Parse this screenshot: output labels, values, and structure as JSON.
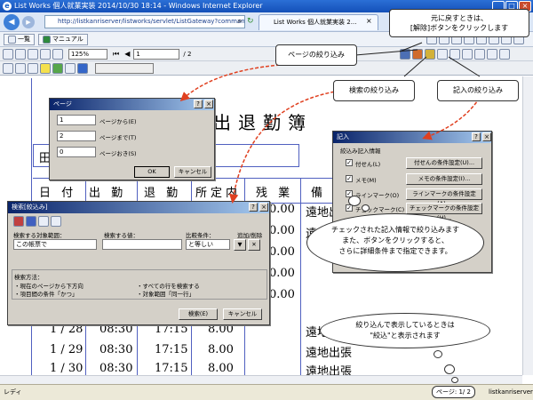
{
  "window": {
    "title": "List Works 個人就業実装 2014/10/30 18:14 - Windows Internet Explorer",
    "min": "_",
    "max": "□",
    "close": "×"
  },
  "browser": {
    "url": "http://listkanriserver/listworks/servlet/ListGateway?command=listbrow",
    "tab_label": "List Works 個人就業実装 2...",
    "nav_back": "◀",
    "nav_fwd": "▶",
    "search": "⌕",
    "refresh": "↻"
  },
  "menubar": {
    "item1": "一覧",
    "item2": "マニュアル"
  },
  "toolbar": {
    "zoom": "125%",
    "page": "1",
    "page_total": "/ 2"
  },
  "document": {
    "title": "出退勤簿",
    "headers": [
      "日 付",
      "出 勤",
      "退 勤",
      "所定内",
      "残 業",
      "備"
    ],
    "rows": [
      {
        "date": "",
        "in": "",
        "out": "",
        "hours": "0.00",
        "note": "遠地出張"
      },
      {
        "date": "",
        "in": "",
        "out": "",
        "hours": "0.00",
        "note": "遠地出張"
      },
      {
        "date": "",
        "in": "",
        "out": "",
        "hours": "0.00",
        "note": ""
      },
      {
        "date": "",
        "in": "",
        "out": "",
        "hours": "0.00",
        "note": ""
      },
      {
        "date": "",
        "in": "",
        "out": "",
        "hours": "0.00",
        "note": ""
      },
      {
        "date": "1 / 28",
        "in": "08:30",
        "out": "17:15",
        "hours": "8.00",
        "note": "遠地出張"
      },
      {
        "date": "1 / 29",
        "in": "08:30",
        "out": "17:15",
        "hours": "8.00",
        "note": "遠地出張"
      },
      {
        "date": "1 / 30",
        "in": "08:30",
        "out": "17:15",
        "hours": "8.00",
        "note": "遠地出張"
      }
    ],
    "name_prefix": "田"
  },
  "page_dialog": {
    "title": "ページ",
    "fields": [
      {
        "value": "1",
        "label": "ページから(E)"
      },
      {
        "value": "2",
        "label": "ページまで(T)"
      },
      {
        "value": "0",
        "label": "ページおき(S)"
      }
    ],
    "ok": "OK",
    "cancel": "キャンセル",
    "help": "?",
    "close": "×"
  },
  "search_dialog": {
    "title": "検索[絞込み]",
    "col1": "検索する対象範囲：",
    "col2": "検索する値：",
    "col3": "比較条件：",
    "col4": "追加/削除",
    "scope_value": "この帳票で",
    "compare_value": "と等しい",
    "method_header": "検索方法：",
    "methods": [
      "・現在のページから下方向",
      "・すべての行を検索する",
      "・項目間の条件「かつ」",
      "・対象範囲「同一行」"
    ],
    "search_btn": "検索(E)",
    "cancel_btn": "キャンセル",
    "help": "?",
    "close": "×"
  },
  "entry_dialog": {
    "title": "記入",
    "section": "絞込み記入情報",
    "items": [
      {
        "label": "付せん(L)",
        "btn": "付せんの条件設定(U)..."
      },
      {
        "label": "メモ(M)",
        "btn": "メモの条件設定(I)..."
      },
      {
        "label": "ラインマーク(O)",
        "btn": "ラインマークの条件設定(A)..."
      },
      {
        "label": "チェックマーク(C)",
        "btn": "チェックマークの条件設定(H)..."
      }
    ],
    "help": "?",
    "close": "×"
  },
  "callouts": {
    "release": "元に戻すときは、\n[解除]ボタンをクリックします",
    "page_filter": "ページの絞り込み",
    "search_filter": "検索の絞り込み",
    "entry_filter": "記入の絞り込み",
    "checked_info": "チェックされた記入情報で絞り込みます\nまた、ボタンをクリックすると、\nさらに詳細条件まで指定できます。",
    "filtered_note": "絞り込んで表示しているときは\n\"絞込\"と表示されます"
  },
  "status": {
    "left": "レディ",
    "page": "ページ: 1/ 2",
    "server": "listkanriserver"
  }
}
